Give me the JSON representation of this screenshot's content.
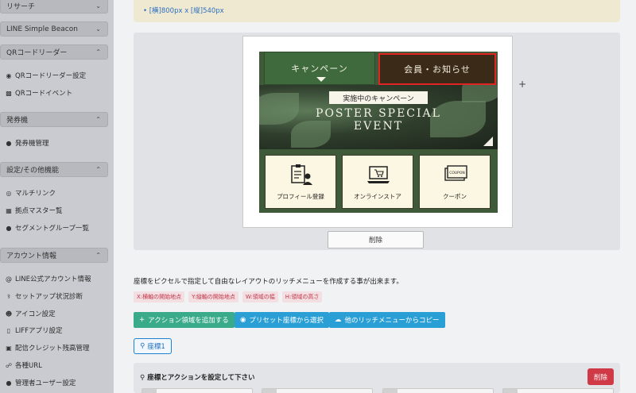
{
  "sidebar": {
    "research_label": "リサーチ",
    "line_beacon_label": "LINE Simple Beacon",
    "qr_section_label": "QRコードリーダー",
    "qr_settings": "QRコードリーダー設定",
    "qr_event": "QRコードイベント",
    "ticket_section_label": "発券機",
    "ticket_manage": "発券機管理",
    "settings_section_label": "設定/その他機能",
    "multilink": "マルチリンク",
    "master": "拠点マスター覧",
    "segment": "セグメントグループ一覧",
    "account_section_label": "アカウント情報",
    "line_official": "LINE公式アカウント情報",
    "setup": "セットアップ状況診断",
    "icon_setting": "アイコン設定",
    "liff": "LIFFアプリ設定",
    "credit": "配信クレジット残高管理",
    "urls": "各種URL",
    "admin_users": "管理者ユーザー設定"
  },
  "notice": {
    "size_text": "[横]800px x [縦]540px"
  },
  "rich_menu": {
    "tab1_label": "キャンペーン",
    "tab2_label": "会員・お知らせ",
    "hero_badge": "実施中のキャンペーン",
    "hero_line1": "POSTER SPECIAL",
    "hero_line2": "EVENT",
    "btn1_label": "プロフィール登録",
    "btn2_label": "オンラインストア",
    "btn3_label": "クーポン",
    "coupon_word": "COUPON"
  },
  "preview_delete_label": "削除",
  "description": "座標をピクセルで指定して自由なレイアウトのリッチメニューを作成する事が出来ます。",
  "tags": [
    "X:横軸の開始地点",
    "Y:縦軸の開始地点",
    "W:領域の幅",
    "H:領域の高さ"
  ],
  "actions": {
    "add_area": "アクション領域を追加する",
    "preset": "プリセット座標から選択",
    "copy": "他のリッチメニューからコピー"
  },
  "coord_tab_label": "座標1",
  "settings_panel": {
    "title": "座標とアクションを設定して下さい",
    "delete_label": "削除"
  },
  "colors": {
    "tab2_highlight": "#e02424",
    "green_button": "#3aab8a",
    "blue_button": "#2a9fd6",
    "red_button": "#cf3a46"
  }
}
